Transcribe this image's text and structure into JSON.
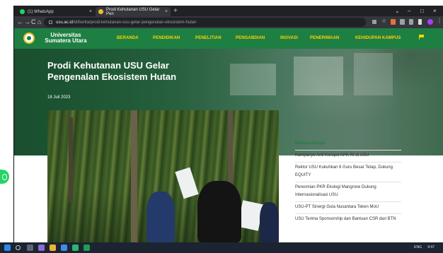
{
  "browser": {
    "tabs": [
      {
        "title": "(1) WhatsApp",
        "favicon_color": "#25d366"
      },
      {
        "title": "Prodi Kehutanan USU Gelar Pen",
        "favicon_color": "#e6c229"
      }
    ],
    "new_tab": "+",
    "window_controls": {
      "chevron": "⌄",
      "minimize": "–",
      "maximize": "□",
      "close": "×"
    },
    "nav": {
      "back": "←",
      "forward": "→",
      "reload": "C",
      "home": "⌂"
    },
    "url_host": "usu.ac.id",
    "url_path": "/id/berita/prodi-kehutanan-usu-gelar-pengenalan-ekosistem-hutan",
    "toolbar_icons": [
      "share-icon",
      "star-icon",
      "extension-icon",
      "puzzle-icon",
      "menu-icon",
      "profile-icon"
    ]
  },
  "site": {
    "brand_line1": "Universitas",
    "brand_line2": "Sumatera Utara",
    "menu": [
      "BERANDA",
      "PENDIDIKAN",
      "PENELITIAN",
      "PENGABDIAN",
      "INOVASI",
      "PENERIMAAN",
      "KEHIDUPAN KAMPUS"
    ],
    "accent": "#ffd400",
    "green": "#1e7f43"
  },
  "article": {
    "title": "Prodi Kehutanan USU Gelar Pengenalan Ekosistem Hutan",
    "date": "18 Juli 2023"
  },
  "sidebar": {
    "title": "Berita Lainnya",
    "items": [
      "Kampanye Anti Korupsi KPK RI di USU",
      "Rektor USU Kukuhkan 6 Guru Besar Tetap, Dukung EQUITY",
      "Peresmian PKR Ekologi Mangrove Dukung Internasionalisasi USU",
      "USU-PT Sinergi Gula Nusantara Teken MoU",
      "USU Terima Sponsorship dan Bantuan CSR dari BTN"
    ]
  },
  "taskbar": {
    "tray_text": "ENG",
    "time": "9:47"
  }
}
